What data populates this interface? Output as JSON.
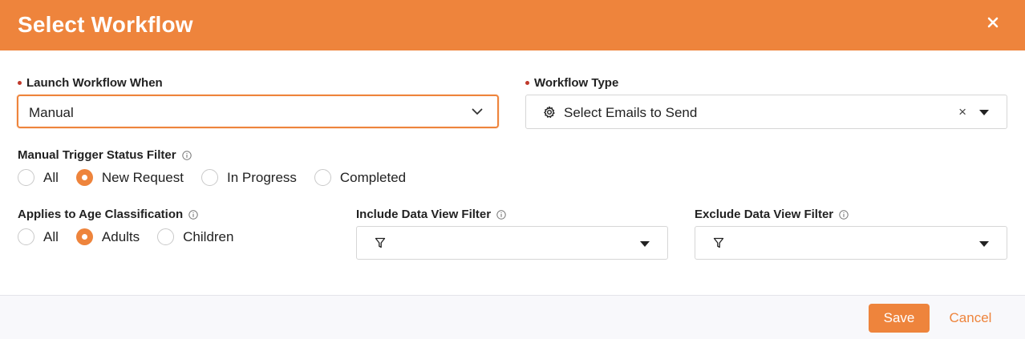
{
  "dialog": {
    "title": "Select Workflow",
    "close_label": "×"
  },
  "launch": {
    "label": "Launch Workflow When",
    "value": "Manual",
    "required": true
  },
  "workflow_type": {
    "label": "Workflow Type",
    "value": "Select Emails to Send",
    "clear_label": "×",
    "required": true
  },
  "status_filter": {
    "label": "Manual Trigger Status Filter",
    "options": [
      "All",
      "New Request",
      "In Progress",
      "Completed"
    ],
    "selected": "New Request"
  },
  "age_classification": {
    "label": "Applies to Age Classification",
    "options": [
      "All",
      "Adults",
      "Children"
    ],
    "selected": "Adults"
  },
  "include_filter": {
    "label": "Include Data View Filter",
    "value": ""
  },
  "exclude_filter": {
    "label": "Exclude Data View Filter",
    "value": ""
  },
  "footer": {
    "save_label": "Save",
    "cancel_label": "Cancel"
  },
  "colors": {
    "accent": "#ee843c",
    "required_dot": "#c0392b"
  },
  "icons": {
    "close": "close-icon",
    "chevron": "chevron-down-icon",
    "caret": "caret-down-icon",
    "gear": "gear-icon",
    "filter": "filter-icon",
    "info": "info-icon"
  }
}
